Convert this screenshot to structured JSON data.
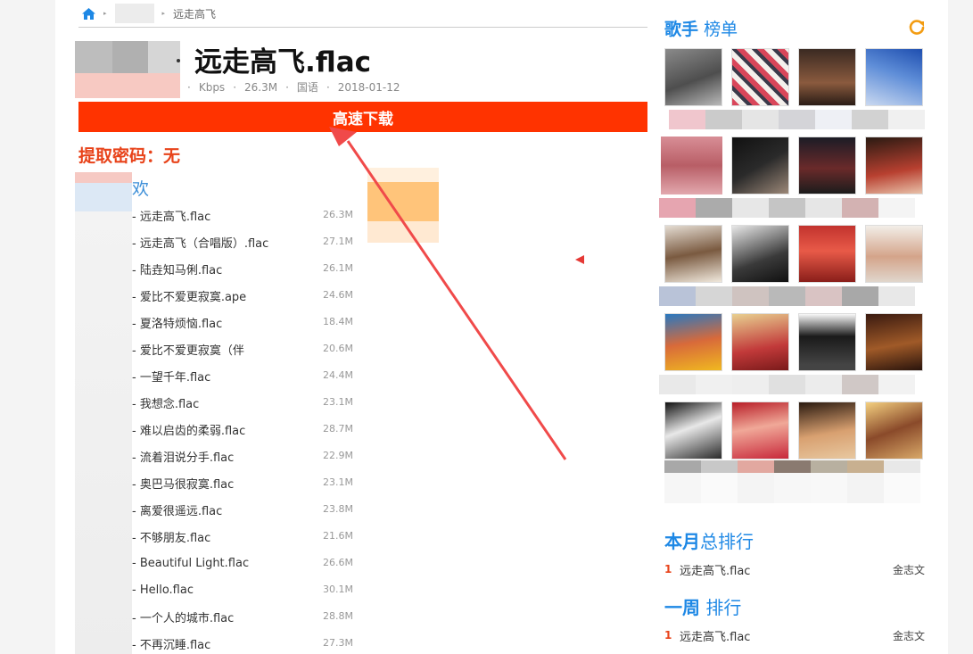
{
  "breadcrumb": {
    "current": "远走高飞"
  },
  "song": {
    "title": "远走高飞.flac",
    "meta": [
      "·",
      "Kbps",
      "·",
      "26.3M",
      "·",
      "国语",
      "·",
      "2018-01-12"
    ]
  },
  "download_label": "高速下载",
  "password_label": "提取密码：无",
  "related_heading": "欢",
  "songs": [
    {
      "name": "- 远走高飞.flac",
      "size": "26.3M"
    },
    {
      "name": "- 远走高飞（合唱版）.flac",
      "size": "27.1M"
    },
    {
      "name": "- 陆垚知马俐.flac",
      "size": "26.1M"
    },
    {
      "name": "- 爱比不爱更寂寞.ape",
      "size": "24.6M"
    },
    {
      "name": "- 夏洛特烦恼.flac",
      "size": "18.4M"
    },
    {
      "name": "- 爱比不爱更寂寞（伴",
      "size": "20.6M"
    },
    {
      "name": "- 一望千年.flac",
      "size": "24.4M"
    },
    {
      "name": "- 我想念.flac",
      "size": "23.1M"
    },
    {
      "name": "- 难以启齿的柔弱.flac",
      "size": "28.7M"
    },
    {
      "name": "- 流着泪说分手.flac",
      "size": "22.9M"
    },
    {
      "name": "- 奥巴马很寂寞.flac",
      "size": "23.1M"
    },
    {
      "name": "- 离爱很遥远.flac",
      "size": "23.8M"
    },
    {
      "name": "- 不够朋友.flac",
      "size": "21.6M"
    },
    {
      "name": "- Beautiful Light.flac",
      "size": "26.6M"
    },
    {
      "name": "- Hello.flac",
      "size": "30.1M"
    },
    {
      "name": "- 一个人的城市.flac",
      "size": "28.8M"
    },
    {
      "name": "- 不再沉睡.flac",
      "size": "27.3M"
    }
  ],
  "sidebar": {
    "artists_heading_a": "歌手",
    "artists_heading_b": "榜单",
    "monthly_heading_a": "本月",
    "monthly_heading_b": "总排行",
    "weekly_heading_a": "一周",
    "weekly_heading_b": "排行",
    "monthly": [
      {
        "rank": "1",
        "song": "远走高飞.flac",
        "artist": "金志文"
      }
    ],
    "weekly": [
      {
        "rank": "1",
        "song": "远走高飞.flac",
        "artist": "金志文"
      }
    ]
  },
  "colors": {
    "accent": "#1e88e5",
    "download": "#ff3300",
    "password": "#e8431a",
    "arrow": "#f04a4a"
  },
  "icons": [
    "home-icon",
    "breadcrumb-chevron-icon",
    "refresh-icon",
    "arrow-annotation",
    "red-triangle-marker"
  ]
}
